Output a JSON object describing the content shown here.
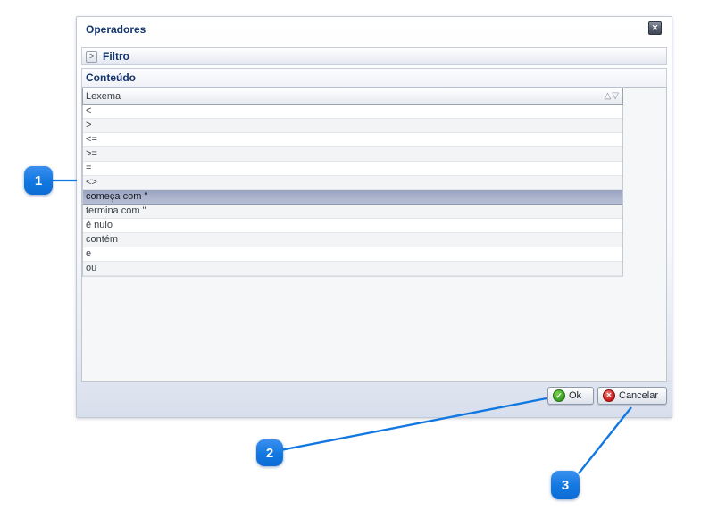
{
  "dialog": {
    "title": "Operadores",
    "filtro": {
      "label": "Filtro",
      "toggle_icon": ">"
    },
    "conteudo": {
      "label": "Conteúdo"
    },
    "table": {
      "column_header": "Lexema",
      "sort_asc_icon": "△",
      "sort_desc_icon": "▽",
      "rows": [
        "<",
        ">",
        "<=",
        ">=",
        "=",
        "<>",
        "começa com \"",
        "termina com \"",
        "é nulo",
        "contém",
        "e",
        "ou"
      ],
      "selected_index": 6
    },
    "buttons": {
      "ok_label": "Ok",
      "ok_icon": "✓",
      "cancel_label": "Cancelar",
      "cancel_icon": "✕"
    },
    "close_icon": "✕"
  },
  "annotations": {
    "badges": [
      "1",
      "2",
      "3"
    ]
  },
  "colors": {
    "accent_blue": "#1178e2",
    "title_navy": "#14356b",
    "selected_row": "#a9b2ca",
    "ok_green": "#45a82c",
    "cancel_red": "#cf2a26"
  }
}
